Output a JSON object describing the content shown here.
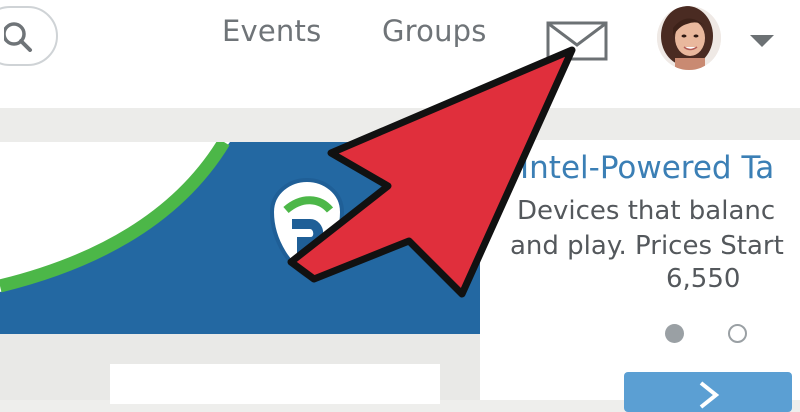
{
  "header": {
    "search_icon": "search-icon",
    "nav": [
      {
        "label": "Events"
      },
      {
        "label": "Groups"
      }
    ],
    "messages_icon": "envelope-icon",
    "profile_menu_icon": "caret-down-icon"
  },
  "promo": {
    "brand_color": "#2368a2",
    "stripe_color": "#4cb748"
  },
  "side_panel": {
    "title": "Intel-Powered Ta",
    "line1": "Devices that balanc",
    "line2": "and play. Prices Start",
    "line3": "6,550",
    "pager": {
      "total": 2,
      "active": 1
    },
    "next_icon": "chevron-right-icon"
  },
  "annotation": {
    "arrow_color": "#e02f3c",
    "outline_color": "#111111"
  }
}
